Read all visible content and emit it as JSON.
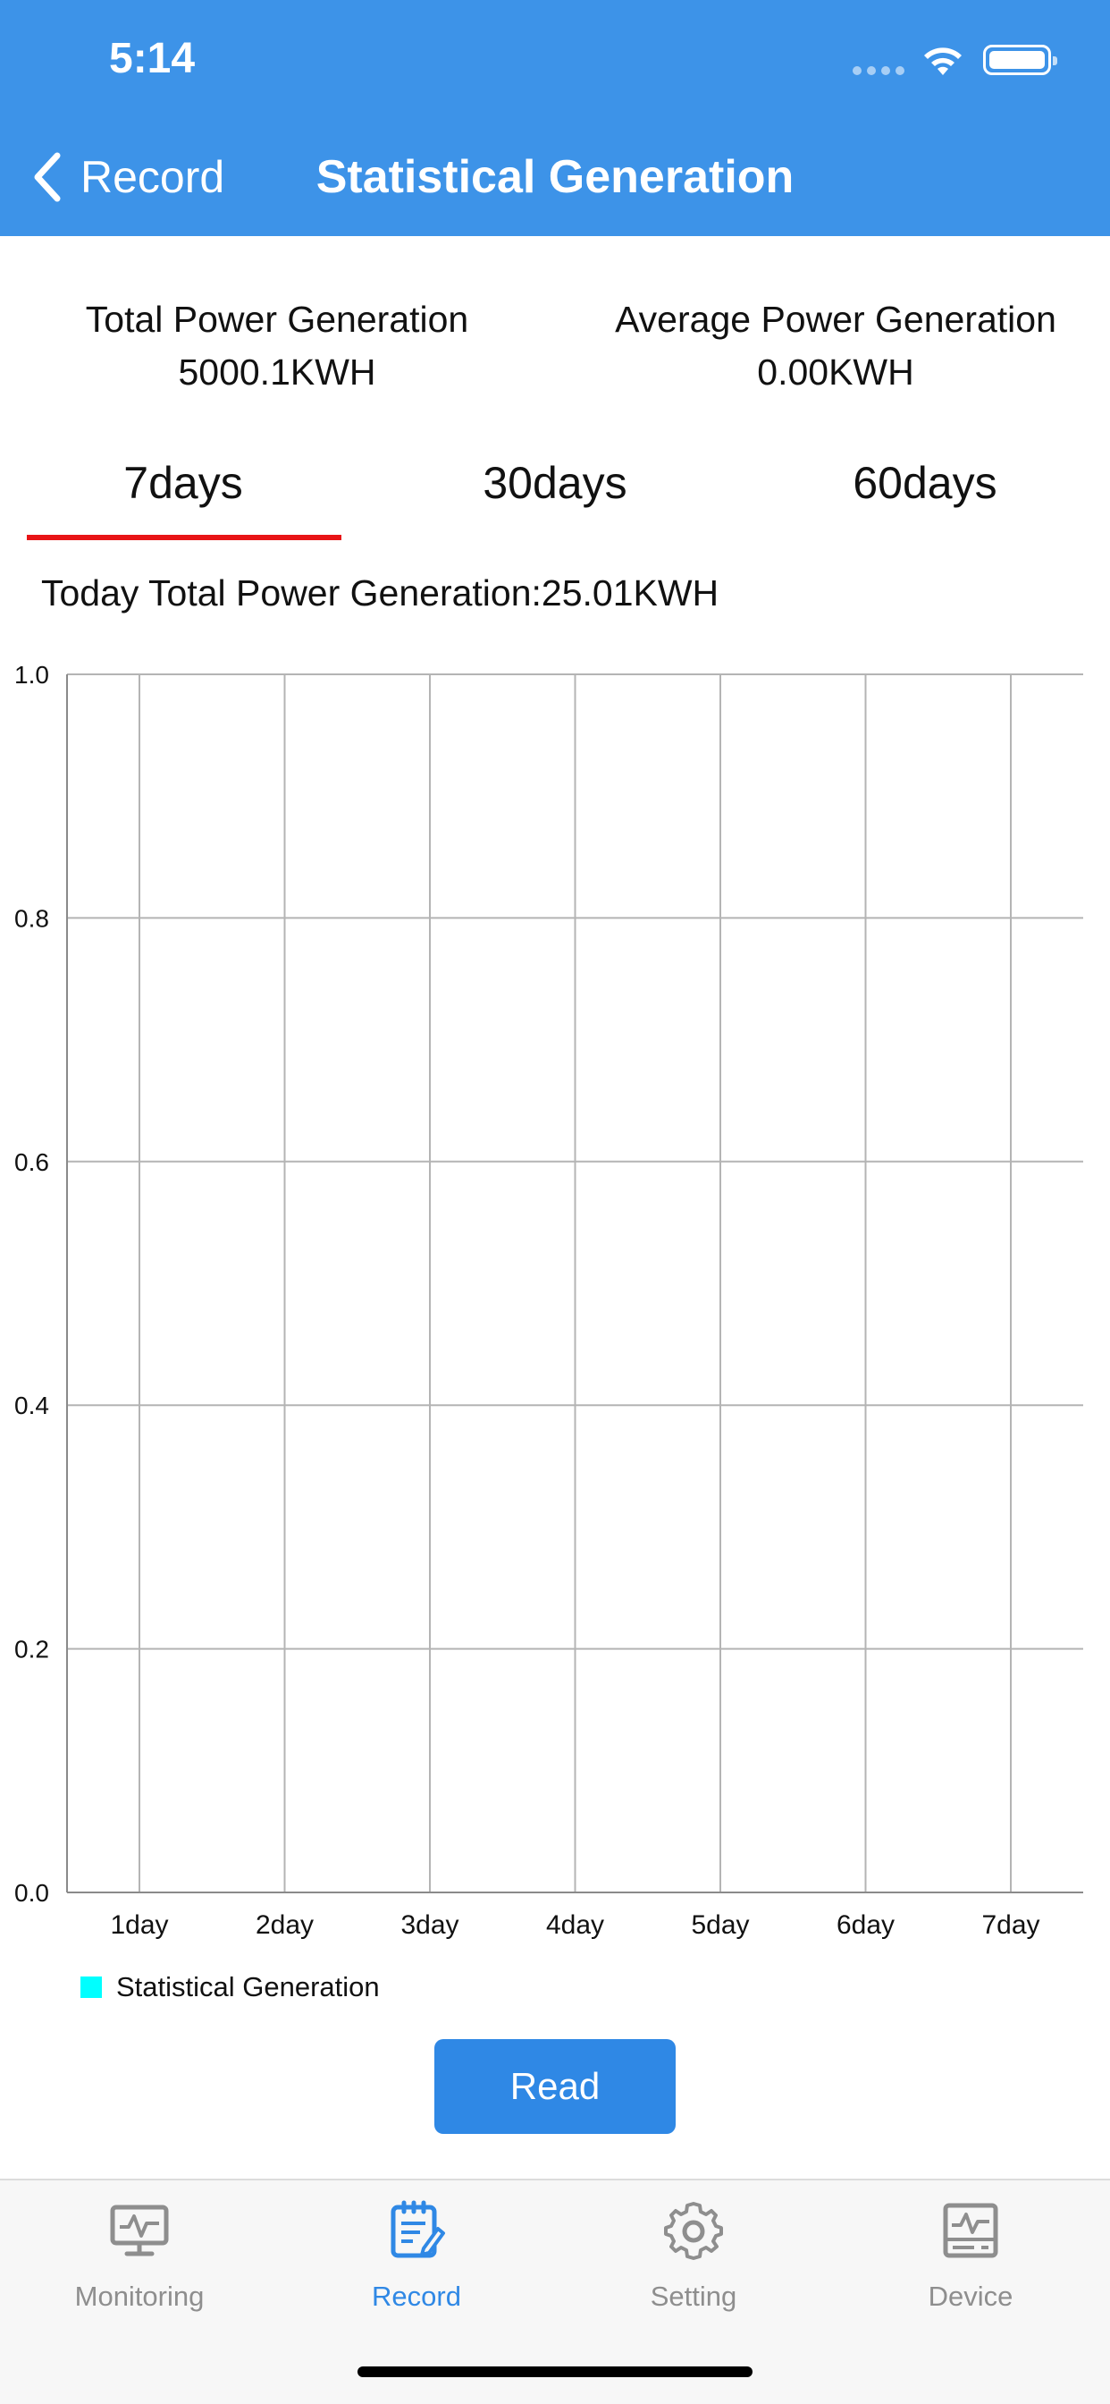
{
  "status_bar": {
    "time": "5:14"
  },
  "nav": {
    "back_label": "Record",
    "title": "Statistical Generation"
  },
  "summary": {
    "total_label": "Total Power Generation",
    "total_value": "5000.1KWH",
    "average_label": "Average Power Generation",
    "average_value": "0.00KWH"
  },
  "tabs": [
    {
      "label": "7days",
      "selected": true
    },
    {
      "label": "30days",
      "selected": false
    },
    {
      "label": "60days",
      "selected": false
    }
  ],
  "today_text": "Today Total Power Generation:25.01KWH",
  "chart_data": {
    "type": "bar",
    "categories": [
      "1day",
      "2day",
      "3day",
      "4day",
      "5day",
      "6day",
      "7day"
    ],
    "series": [
      {
        "name": "Statistical Generation",
        "values": [
          0,
          0,
          0,
          0,
          0,
          0,
          0
        ],
        "color": "#00ffff"
      }
    ],
    "ylim": [
      0.0,
      1.0
    ],
    "yticks": [
      "0.0",
      "0.2",
      "0.4",
      "0.6",
      "0.8",
      "1.0"
    ],
    "grid": true,
    "legend": "bottom-left"
  },
  "read_button": "Read",
  "tabbar": [
    {
      "label": "Monitoring",
      "icon": "monitor-icon",
      "active": false
    },
    {
      "label": "Record",
      "icon": "record-icon",
      "active": true
    },
    {
      "label": "Setting",
      "icon": "gear-icon",
      "active": false
    },
    {
      "label": "Device",
      "icon": "device-icon",
      "active": false
    }
  ],
  "colors": {
    "header": "#3d93e8",
    "accent": "#2f88e5",
    "tab_indicator": "#e81416",
    "series": "#00ffff"
  }
}
